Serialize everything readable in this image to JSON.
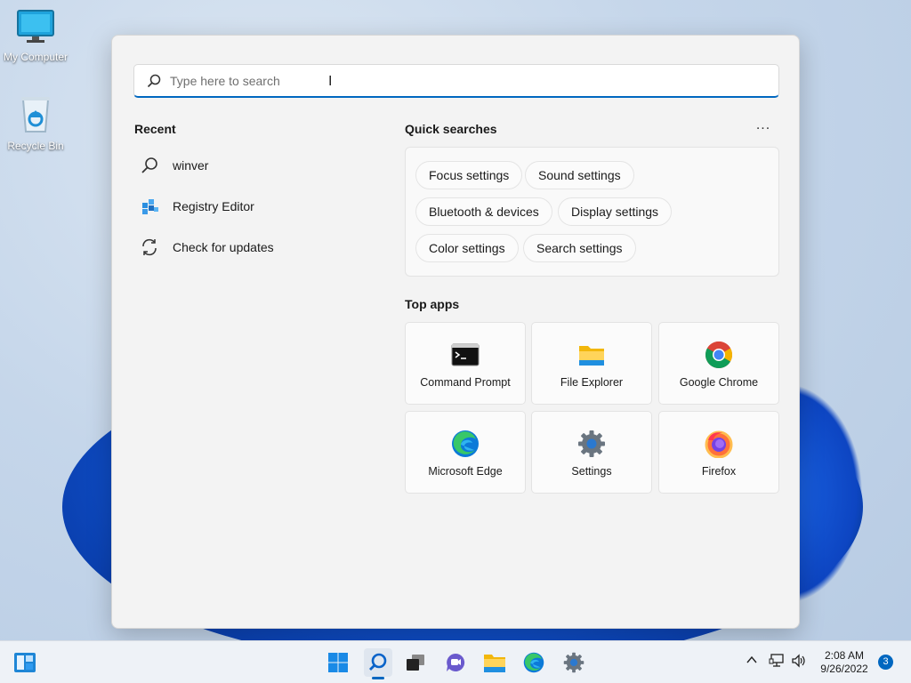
{
  "desktop": {
    "icons": [
      {
        "label": "My Computer",
        "icon": "monitor-icon"
      },
      {
        "label": "Recycle Bin",
        "icon": "recycle-bin-icon"
      }
    ]
  },
  "search": {
    "placeholder": "Type here to search",
    "value": ""
  },
  "recent": {
    "title": "Recent",
    "items": [
      {
        "label": "winver",
        "icon": "search-icon"
      },
      {
        "label": "Registry Editor",
        "icon": "registry-editor-icon"
      },
      {
        "label": "Check for updates",
        "icon": "refresh-icon"
      }
    ]
  },
  "quick_searches": {
    "title": "Quick searches",
    "more": "...",
    "chips": [
      "Focus settings",
      "Sound settings",
      "Bluetooth & devices",
      "Display settings",
      "Color settings",
      "Search settings"
    ]
  },
  "top_apps": {
    "title": "Top apps",
    "apps": [
      {
        "label": "Command Prompt",
        "icon": "command-prompt-icon"
      },
      {
        "label": "File Explorer",
        "icon": "file-explorer-icon"
      },
      {
        "label": "Google Chrome",
        "icon": "chrome-icon"
      },
      {
        "label": "Microsoft Edge",
        "icon": "edge-icon"
      },
      {
        "label": "Settings",
        "icon": "settings-gear-icon"
      },
      {
        "label": "Firefox",
        "icon": "firefox-icon"
      }
    ]
  },
  "taskbar": {
    "pinned": [
      "start-icon",
      "search-icon",
      "task-view-icon",
      "teams-chat-icon",
      "file-explorer-icon",
      "edge-icon",
      "settings-gear-icon"
    ],
    "clock_time": "2:08 AM",
    "clock_date": "9/26/2022",
    "notification_count": "3"
  },
  "colors": {
    "accent": "#0067c0",
    "panel_bg": "#f3f3f3"
  }
}
